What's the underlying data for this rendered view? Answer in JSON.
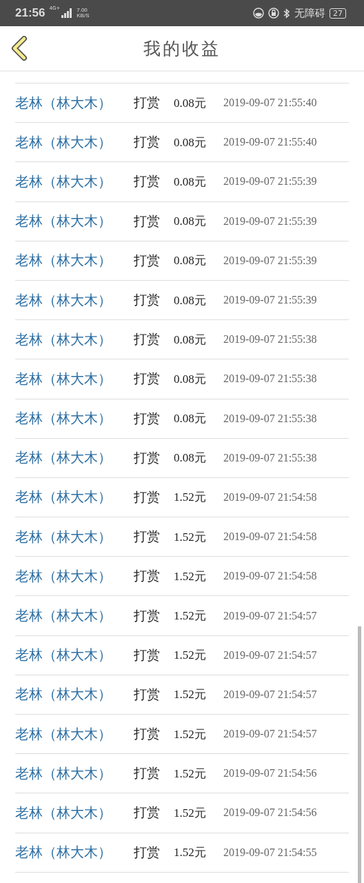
{
  "status_bar": {
    "time": "21:56",
    "network": "4G+",
    "speed_value": "7.00",
    "speed_unit": "KB/S",
    "accessibility": "无障碍",
    "battery": "27"
  },
  "header": {
    "title": "我的收益"
  },
  "records": [
    {
      "name": "老林（林大木）",
      "action": "打赏",
      "amount": "0.08元",
      "time": "2019-09-07 21:55:40"
    },
    {
      "name": "老林（林大木）",
      "action": "打赏",
      "amount": "0.08元",
      "time": "2019-09-07 21:55:40"
    },
    {
      "name": "老林（林大木）",
      "action": "打赏",
      "amount": "0.08元",
      "time": "2019-09-07 21:55:39"
    },
    {
      "name": "老林（林大木）",
      "action": "打赏",
      "amount": "0.08元",
      "time": "2019-09-07 21:55:39"
    },
    {
      "name": "老林（林大木）",
      "action": "打赏",
      "amount": "0.08元",
      "time": "2019-09-07 21:55:39"
    },
    {
      "name": "老林（林大木）",
      "action": "打赏",
      "amount": "0.08元",
      "time": "2019-09-07 21:55:39"
    },
    {
      "name": "老林（林大木）",
      "action": "打赏",
      "amount": "0.08元",
      "time": "2019-09-07 21:55:38"
    },
    {
      "name": "老林（林大木）",
      "action": "打赏",
      "amount": "0.08元",
      "time": "2019-09-07 21:55:38"
    },
    {
      "name": "老林（林大木）",
      "action": "打赏",
      "amount": "0.08元",
      "time": "2019-09-07 21:55:38"
    },
    {
      "name": "老林（林大木）",
      "action": "打赏",
      "amount": "0.08元",
      "time": "2019-09-07 21:55:38"
    },
    {
      "name": "老林（林大木）",
      "action": "打赏",
      "amount": "1.52元",
      "time": "2019-09-07 21:54:58"
    },
    {
      "name": "老林（林大木）",
      "action": "打赏",
      "amount": "1.52元",
      "time": "2019-09-07 21:54:58"
    },
    {
      "name": "老林（林大木）",
      "action": "打赏",
      "amount": "1.52元",
      "time": "2019-09-07 21:54:58"
    },
    {
      "name": "老林（林大木）",
      "action": "打赏",
      "amount": "1.52元",
      "time": "2019-09-07 21:54:57"
    },
    {
      "name": "老林（林大木）",
      "action": "打赏",
      "amount": "1.52元",
      "time": "2019-09-07 21:54:57"
    },
    {
      "name": "老林（林大木）",
      "action": "打赏",
      "amount": "1.52元",
      "time": "2019-09-07 21:54:57"
    },
    {
      "name": "老林（林大木）",
      "action": "打赏",
      "amount": "1.52元",
      "time": "2019-09-07 21:54:57"
    },
    {
      "name": "老林（林大木）",
      "action": "打赏",
      "amount": "1.52元",
      "time": "2019-09-07 21:54:56"
    },
    {
      "name": "老林（林大木）",
      "action": "打赏",
      "amount": "1.52元",
      "time": "2019-09-07 21:54:56"
    },
    {
      "name": "老林（林大木）",
      "action": "打赏",
      "amount": "1.52元",
      "time": "2019-09-07 21:54:55"
    }
  ]
}
